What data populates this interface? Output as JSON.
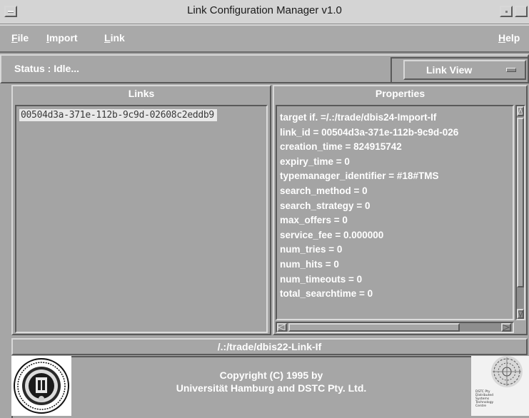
{
  "window": {
    "title": "Link Configuration Manager v1.0"
  },
  "menubar": {
    "items": [
      {
        "label": "File",
        "mnemonic": "F",
        "rest": "ile"
      },
      {
        "label": "Import",
        "mnemonic": "I",
        "rest": "mport"
      },
      {
        "label": "Link",
        "mnemonic": "L",
        "rest": "ink"
      }
    ],
    "help": {
      "label": "Help",
      "mnemonic": "H",
      "rest": "elp"
    }
  },
  "status": {
    "text": "Status : Idle..."
  },
  "view_selector": {
    "label": "Link View"
  },
  "links_panel": {
    "header": "Links",
    "items": [
      "00504d3a-371e-112b-9c9d-02608c2eddb9"
    ]
  },
  "properties_panel": {
    "header": "Properties",
    "lines": [
      "target if. =/.:/trade/dbis24-Import-If",
      "link_id = 00504d3a-371e-112b-9c9d-026",
      "creation_time = 824915742",
      "expiry_time = 0",
      "typemanager_identifier = #18#TMS",
      "search_method = 0",
      "search_strategy = 0",
      "max_offers = 0",
      "service_fee = 0.000000",
      "num_tries = 0",
      "num_hits = 0",
      "num_timeouts = 0",
      "total_searchtime = 0"
    ]
  },
  "path": {
    "text": "/.:/trade/dbis22-Link-If"
  },
  "footer": {
    "copyright_line1": "Copyright (C) 1995 by",
    "copyright_line2": "Universität Hamburg and DSTC Pty. Ltd.",
    "right_logo_text": [
      "DSTC Pty",
      "Distributed",
      "Systems",
      "Technology",
      "Centre"
    ]
  },
  "icons": {
    "window_menu": "window-menu-icon",
    "minimize": "minimize-icon",
    "maximize": "maximize-icon",
    "option_menu": "option-menu-indicator-icon",
    "scroll_up": "arrow-up-icon",
    "scroll_down": "arrow-down-icon",
    "scroll_left": "arrow-left-icon",
    "scroll_right": "arrow-right-icon",
    "left_logo": "university-seal-logo",
    "right_logo": "dstc-logo"
  }
}
